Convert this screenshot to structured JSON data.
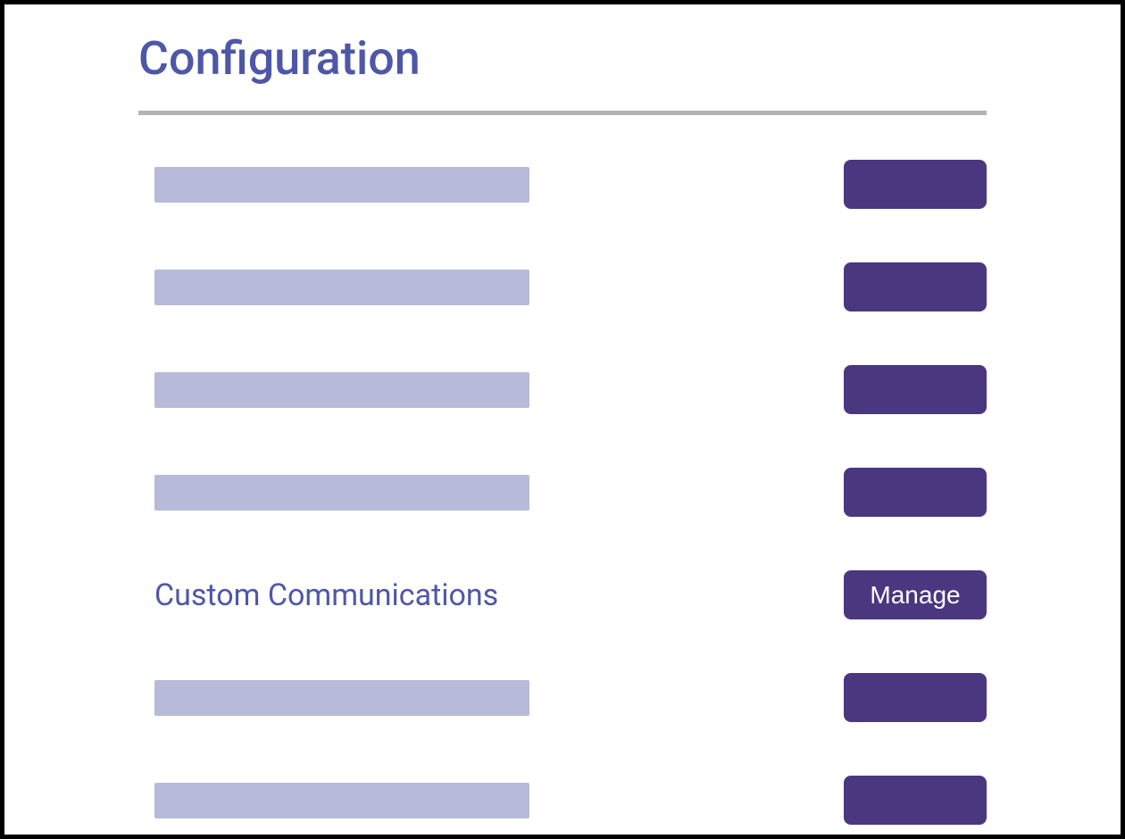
{
  "page": {
    "title": "Configuration"
  },
  "rows": [
    {
      "label": "",
      "button_label": "",
      "placeholder": true
    },
    {
      "label": "",
      "button_label": "",
      "placeholder": true
    },
    {
      "label": "",
      "button_label": "",
      "placeholder": true
    },
    {
      "label": "",
      "button_label": "",
      "placeholder": true
    },
    {
      "label": "Custom Communications",
      "button_label": "Manage",
      "placeholder": false
    },
    {
      "label": "",
      "button_label": "",
      "placeholder": true
    },
    {
      "label": "",
      "button_label": "",
      "placeholder": true
    }
  ],
  "colors": {
    "accent_text": "#4e57a7",
    "button_bg": "#4a3780",
    "placeholder_bg": "#b7bad9",
    "divider": "#b2b2b2"
  }
}
